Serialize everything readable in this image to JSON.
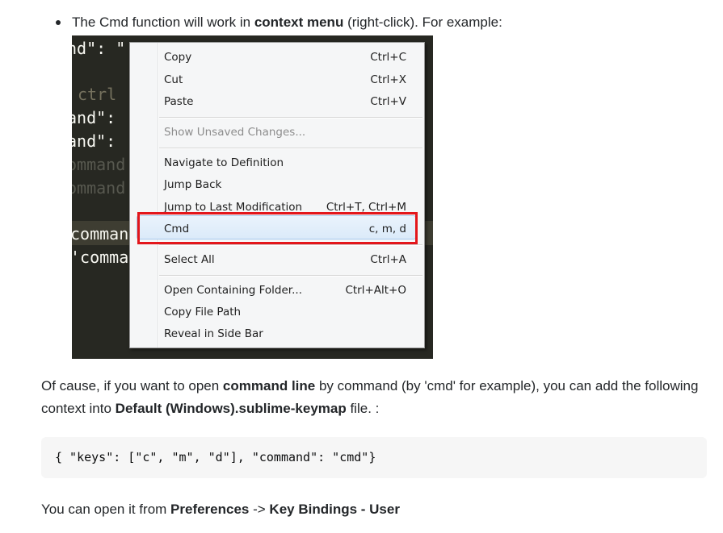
{
  "intro": {
    "text_before": "The Cmd function will work in ",
    "bold": "context menu",
    "text_after": " (right-click). For example:"
  },
  "editor": {
    "lines": [
      {
        "text": "nd\": \"",
        "color": "#f8f8f2"
      },
      {
        "text": "ctrl",
        "color": "#75715e"
      },
      {
        "text": "and\":",
        "color": "#f8f8f2"
      },
      {
        "text": "and\":",
        "color": "#f8f8f2"
      },
      {
        "text": "ommand",
        "color": "#57584f"
      },
      {
        "text": "ommand",
        "color": "#57584f"
      },
      {
        "text": "comman",
        "color": "#f8f8f2"
      },
      {
        "text": "'comma",
        "color": "#f8f8f2"
      }
    ]
  },
  "context_menu": {
    "items": [
      {
        "label": "Copy",
        "shortcut": "Ctrl+C",
        "disabled": false
      },
      {
        "label": "Cut",
        "shortcut": "Ctrl+X",
        "disabled": false
      },
      {
        "label": "Paste",
        "shortcut": "Ctrl+V",
        "disabled": false
      },
      {
        "label": "Show Unsaved Changes...",
        "shortcut": "",
        "disabled": true
      },
      {
        "label": "Navigate to Definition",
        "shortcut": "",
        "disabled": false
      },
      {
        "label": "Jump Back",
        "shortcut": "",
        "disabled": false
      },
      {
        "label": "Jump to Last Modification",
        "shortcut": "Ctrl+T, Ctrl+M",
        "disabled": false
      },
      {
        "label": "Cmd",
        "shortcut": "c, m, d",
        "disabled": false
      },
      {
        "label": "Select All",
        "shortcut": "Ctrl+A",
        "disabled": false
      },
      {
        "label": "Open Containing Folder...",
        "shortcut": "Ctrl+Alt+O",
        "disabled": false
      },
      {
        "label": "Copy File Path",
        "shortcut": "",
        "disabled": false
      },
      {
        "label": "Reveal in Side Bar",
        "shortcut": "",
        "disabled": false
      }
    ],
    "highlight_color": "#e3161b"
  },
  "paragraph": {
    "t1": "Of cause, if you want to open ",
    "b1": "command line",
    "t2": " by command (by 'cmd' for example), you can add the following context into ",
    "b2": "Default (Windows).sublime-keymap",
    "t3": " file. :"
  },
  "code": "{ \"keys\": [\"c\", \"m\", \"d\"], \"command\": \"cmd\"}",
  "footer": {
    "t1": "You can open it from ",
    "b1": "Preferences",
    "t2": " -> ",
    "b2": "Key Bindings - User"
  }
}
